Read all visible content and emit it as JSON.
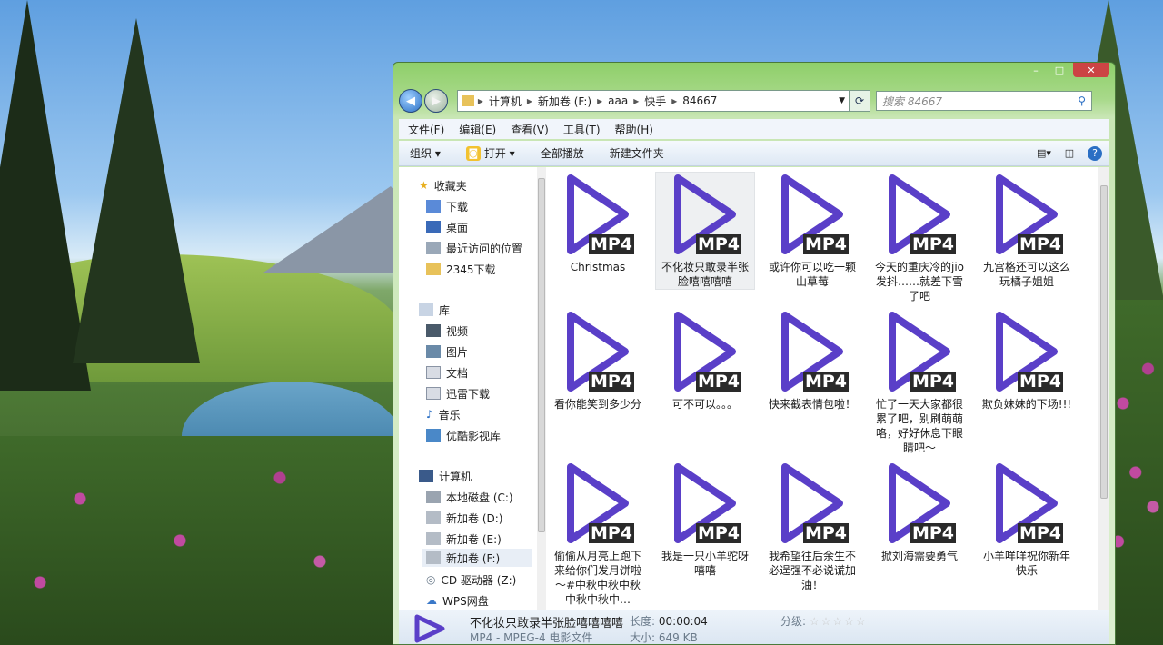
{
  "window": {
    "controls": [
      "–",
      "□",
      "✕"
    ]
  },
  "address": {
    "segments": [
      "计算机",
      "新加卷 (F:)",
      "aaa",
      "快手",
      "84667"
    ]
  },
  "search": {
    "placeholder": "搜索 84667"
  },
  "menu": [
    "文件(F)",
    "编辑(E)",
    "查看(V)",
    "工具(T)",
    "帮助(H)"
  ],
  "toolbar": {
    "organize": "组织 ▾",
    "open": "打开 ▾",
    "play_all": "全部播放",
    "new_folder": "新建文件夹"
  },
  "nav": {
    "favorites": "收藏夹",
    "fav_items": [
      "下载",
      "桌面",
      "最近访问的位置",
      "2345下载"
    ],
    "libraries": "库",
    "lib_items": [
      "视频",
      "图片",
      "文档",
      "迅雷下载",
      "音乐",
      "优酷影视库"
    ],
    "computer": "计算机",
    "drives": [
      "本地磁盘 (C:)",
      "新加卷 (D:)",
      "新加卷 (E:)",
      "新加卷 (F:)",
      "CD 驱动器 (Z:)",
      "WPS网盘"
    ]
  },
  "badge": "MP4",
  "files": [
    "Christmas",
    "不化妆只敢录半张脸嘻嘻嘻嘻",
    "或许你可以吃一颗山草莓",
    "今天的重庆冷的jio发抖……就差下雪了吧",
    "九宫格还可以这么玩橘子姐姐",
    "看你能笑到多少分",
    "可不可以。。。",
    "快来截表情包啦！",
    "忙了一天大家都很累了吧，别刷萌萌咯，好好休息下眼睛吧～",
    "欺负妹妹的下场!!!",
    "偷偷从月亮上跑下来给你们发月饼啦～#中秋中秋中秋中秋中秋中…",
    "我是一只小羊驼呀嘻嘻",
    "我希望往后余生不必逞强不必说谎加油！",
    "掀刘海需要勇气",
    "小羊咩咩祝你新年快乐"
  ],
  "details": {
    "title": "不化妆只敢录半张脸嘻嘻嘻嘻",
    "type": "MP4 - MPEG-4 电影文件",
    "duration_label": "长度:",
    "duration": "00:00:04",
    "size": "大小: 649 KB",
    "rating_label": "分级:",
    "stars": "☆☆☆☆☆"
  },
  "colors": {
    "play": "#5a3fc8",
    "badge_bg": "#2a2a2a",
    "accent": "#2b6fc4"
  }
}
